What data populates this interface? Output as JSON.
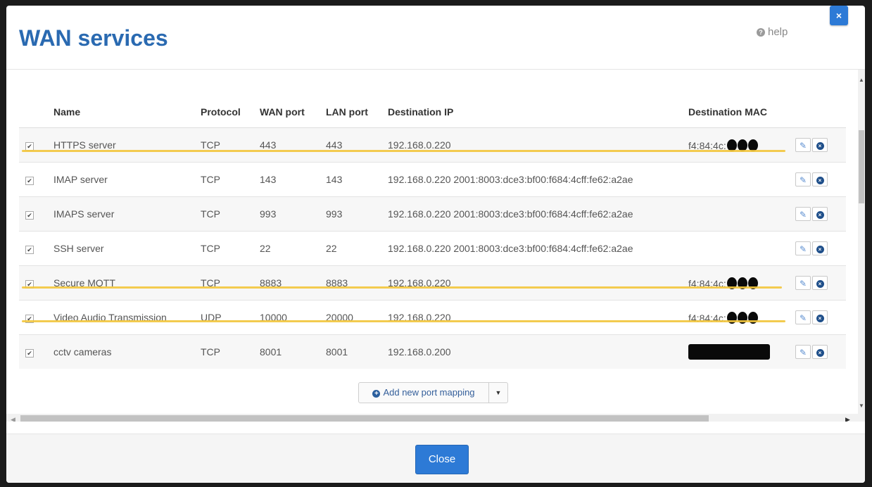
{
  "modal": {
    "title": "WAN services",
    "help_label": "help",
    "close_x": "×",
    "close_button": "Close"
  },
  "table": {
    "headers": [
      "",
      "Name",
      "Protocol",
      "WAN port",
      "LAN port",
      "Destination IP",
      "Destination MAC",
      ""
    ],
    "rows": [
      {
        "checked": true,
        "name": "HTTPS server",
        "protocol": "TCP",
        "wan_port": "443",
        "lan_port": "443",
        "dest_ip": "192.168.0.220",
        "dest_mac": "f4:84:4c:",
        "mac_redaction": "blobs"
      },
      {
        "checked": true,
        "name": "IMAP server",
        "protocol": "TCP",
        "wan_port": "143",
        "lan_port": "143",
        "dest_ip": "192.168.0.220 2001:8003:dce3:bf00:f684:4cff:fe62:a2ae",
        "dest_mac": "",
        "mac_redaction": "none"
      },
      {
        "checked": true,
        "name": "IMAPS server",
        "protocol": "TCP",
        "wan_port": "993",
        "lan_port": "993",
        "dest_ip": "192.168.0.220 2001:8003:dce3:bf00:f684:4cff:fe62:a2ae",
        "dest_mac": "",
        "mac_redaction": "none"
      },
      {
        "checked": true,
        "name": "SSH server",
        "protocol": "TCP",
        "wan_port": "22",
        "lan_port": "22",
        "dest_ip": "192.168.0.220 2001:8003:dce3:bf00:f684:4cff:fe62:a2ae",
        "dest_mac": "",
        "mac_redaction": "none"
      },
      {
        "checked": true,
        "name": "Secure MQTT",
        "protocol": "TCP",
        "wan_port": "8883",
        "lan_port": "8883",
        "dest_ip": "192.168.0.220",
        "dest_mac": "f4:84:4c:",
        "mac_redaction": "blobs"
      },
      {
        "checked": true,
        "name": "Video Audio Transmission",
        "protocol": "UDP",
        "wan_port": "10000",
        "lan_port": "20000",
        "dest_ip": "192.168.0.220",
        "dest_mac": "f4:84:4c:",
        "mac_redaction": "blobs"
      },
      {
        "checked": true,
        "name": "cctv cameras",
        "protocol": "TCP",
        "wan_port": "8001",
        "lan_port": "8001",
        "dest_ip": "192.168.0.200",
        "dest_mac": "",
        "mac_redaction": "bar"
      }
    ]
  },
  "add_mapping": {
    "label": "Add new port mapping"
  },
  "icons": {
    "checkbox": "checkbox-checked-icon",
    "edit": "edit-icon",
    "delete": "delete-circle-icon",
    "help": "help-circle-icon",
    "plus": "plus-circle-icon",
    "caret": "caret-down-icon"
  },
  "colors": {
    "title": "#2a6ab1",
    "primary_button": "#2d7ad6",
    "highlight_underline": "#f2c53c"
  }
}
